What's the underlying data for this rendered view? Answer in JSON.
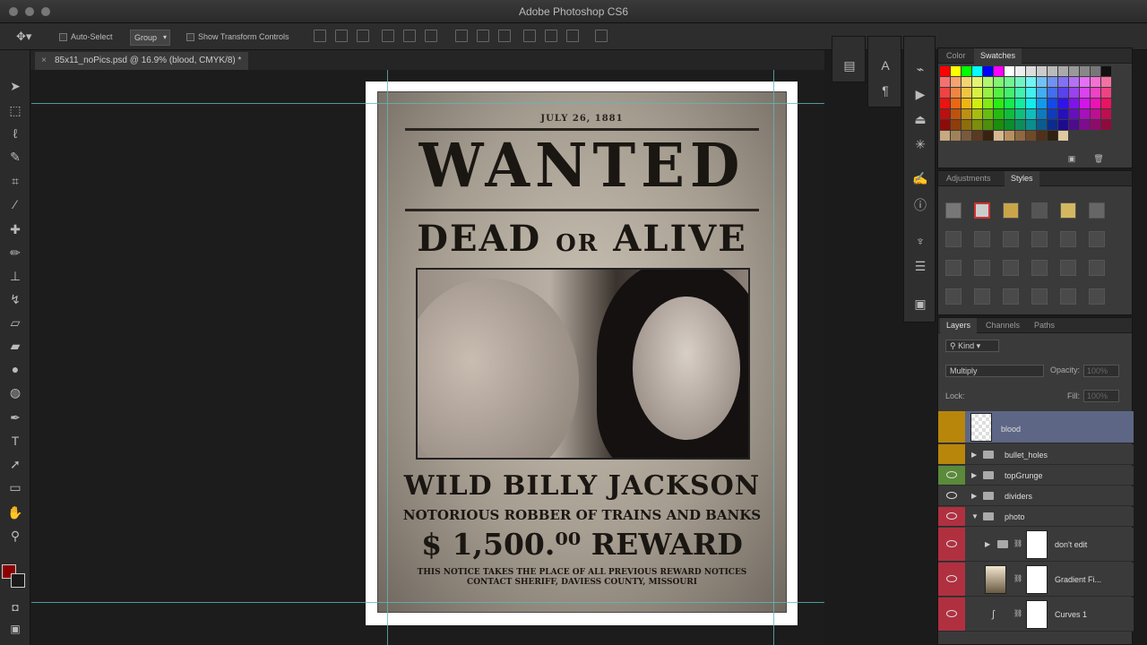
{
  "app": {
    "title": "Adobe Photoshop CS6"
  },
  "options_bar": {
    "auto_select_label": "Auto-Select",
    "auto_select_mode": "Group",
    "show_transform_label": "Show Transform Controls"
  },
  "document": {
    "tab_label": "85x11_noPics.psd @ 16.9% (blood, CMYK/8) *"
  },
  "poster": {
    "date": "JULY 26, 1881",
    "headline": "WANTED",
    "status_pre": "DEAD ",
    "status_or": "OR",
    "status_post": " ALIVE",
    "name": "WILD BILLY JACKSON",
    "subtitle": "NOTORIOUS ROBBER OF TRAINS AND BANKS",
    "reward": "$ 1,500.⁰⁰ REWARD",
    "notice_line1": "THIS NOTICE TAKES THE PLACE OF ALL PREVIOUS REWARD NOTICES",
    "notice_line2": "CONTACT SHERIFF, DAVIESS COUNTY, MISSOURI"
  },
  "panels": {
    "color_tab": "Color",
    "swatches_tab": "Swatches",
    "adjustments_tab": "Adjustments",
    "styles_tab": "Styles",
    "layers_tab": "Layers",
    "channels_tab": "Channels",
    "paths_tab": "Paths"
  },
  "layers_panel": {
    "filter_kind": "Kind",
    "blend_mode": "Multiply",
    "opacity_label": "Opacity:",
    "opacity_value": "100%",
    "lock_label": "Lock:",
    "fill_label": "Fill:",
    "fill_value": "100%",
    "layers": [
      {
        "name": "blood",
        "eye_color": "#b8860b"
      },
      {
        "name": "bullet_holes",
        "eye_color": "#b8860b"
      },
      {
        "name": "topGrunge",
        "eye_color": "#5a8a3a"
      },
      {
        "name": "dividers",
        "eye_color": "#3a3a3a"
      },
      {
        "name": "photo",
        "eye_color": "#b03040"
      },
      {
        "name": "don't edit",
        "eye_color": "#b03040"
      },
      {
        "name": "Gradient Fi...",
        "eye_color": "#b03040"
      },
      {
        "name": "Curves 1",
        "eye_color": "#b03040"
      }
    ]
  },
  "colors": {
    "foreground": "#8b0000",
    "background": "#1a1a1a",
    "guide": "#5fb8b8",
    "selected_layer": "#5d6785"
  }
}
